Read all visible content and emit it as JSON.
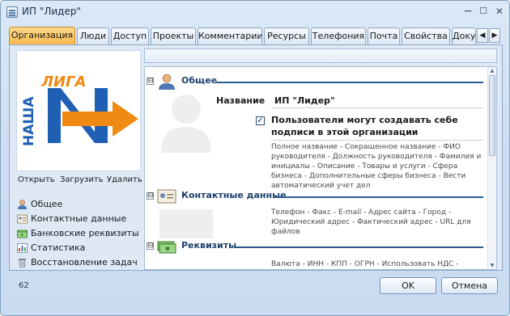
{
  "window": {
    "title": "ИП \"Лидер\"",
    "minimize": "−",
    "maximize": "☐",
    "close": "✕"
  },
  "tabs": [
    {
      "label": "Организация",
      "active": true
    },
    {
      "label": "Люди"
    },
    {
      "label": "Доступ"
    },
    {
      "label": "Проекты"
    },
    {
      "label": "Комментарии"
    },
    {
      "label": "Ресурсы"
    },
    {
      "label": "Телефония"
    },
    {
      "label": "Почта"
    },
    {
      "label": "Свойства"
    },
    {
      "label": "Доку"
    }
  ],
  "tab_scroll": {
    "left": "◀",
    "right": "▶"
  },
  "logo": {
    "line1": "ЛИГА",
    "line2": "НАША",
    "colors": {
      "blue": "#1f5fb4",
      "orange": "#f08a12"
    }
  },
  "logo_actions": {
    "open": "Открыть",
    "upload": "Загрузить",
    "delete": "Удалить"
  },
  "left_nav": [
    {
      "label": "Общее",
      "icon": "person-icon"
    },
    {
      "label": "Контактные данные",
      "icon": "contact-card-icon"
    },
    {
      "label": "Банковские реквизиты",
      "icon": "bank-notes-icon"
    },
    {
      "label": "Статистика",
      "icon": "stats-icon"
    },
    {
      "label": "Восстановление задач",
      "icon": "trash-icon"
    }
  ],
  "sections": {
    "general": {
      "toggle": "⊟",
      "title": "Общее",
      "name_label": "Название",
      "name_value": "ИП \"Лидер\"",
      "checkbox_checked": true,
      "checkbox_mark": "✓",
      "checkbox_label": "Пользователи могут создавать себе подписи в этой организации",
      "description": "Полное название - Сокращенное название - ФИО руководителя - Должность руководителя - Фамилия и инициалы - Описание - Товары и услуги - Сфера бизнеса - Дополнительные сферы бизнеса - Вести автоматический учет дел"
    },
    "contacts": {
      "toggle": "⊟",
      "title": "Контактные данные",
      "description": "Телефон - Факс - E-mail - Адрес сайта - Город - Юридический адрес - Фактический адрес - URL для файлов"
    },
    "requisites": {
      "toggle": "⊟",
      "title": "Реквизиты",
      "description": "Валюта - ИНН - КПП - ОГРН - Использовать НДС -"
    }
  },
  "footer": {
    "counter": "62",
    "ok": "OK",
    "cancel": "Отмена"
  },
  "colors": {
    "accent_tab": "#f7b94e",
    "section_title": "#1f3f6d",
    "section_line": "#2c5a91"
  }
}
